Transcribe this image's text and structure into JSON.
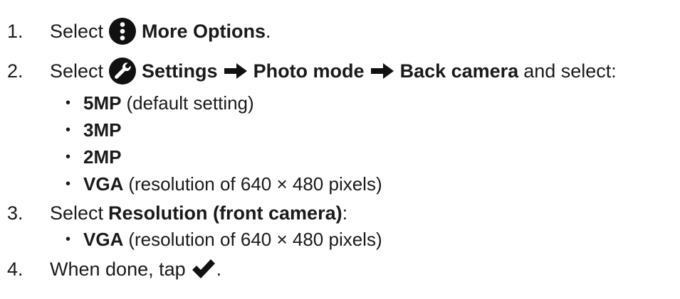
{
  "steps": [
    {
      "number": "1.",
      "text": "Select",
      "icon": "more-options-icon",
      "bold": "More Options",
      "tail": "."
    },
    {
      "number": "2.",
      "text": "Select",
      "icon": "wrench-icon",
      "bold1": "Settings",
      "arrow_icon": "right-arrow-icon",
      "bold2": "Photo mode",
      "bold3": "Back camera",
      "tail": "and select:",
      "options": [
        {
          "bold": "5MP",
          "text": "(default setting)"
        },
        {
          "bold": "3MP",
          "text": ""
        },
        {
          "bold": "2MP",
          "text": ""
        },
        {
          "bold": "VGA",
          "text": "(resolution of 640 × 480 pixels)"
        }
      ]
    },
    {
      "number": "3.",
      "text": "Select",
      "bold": "Resolution (front camera)",
      "tail": ":",
      "options": [
        {
          "bold": "VGA",
          "text": "(resolution of 640 × 480 pixels)"
        }
      ]
    },
    {
      "number": "4.",
      "text": "When done, tap",
      "icon": "checkmark-icon",
      "tail": "."
    }
  ],
  "bullet_char": "•"
}
